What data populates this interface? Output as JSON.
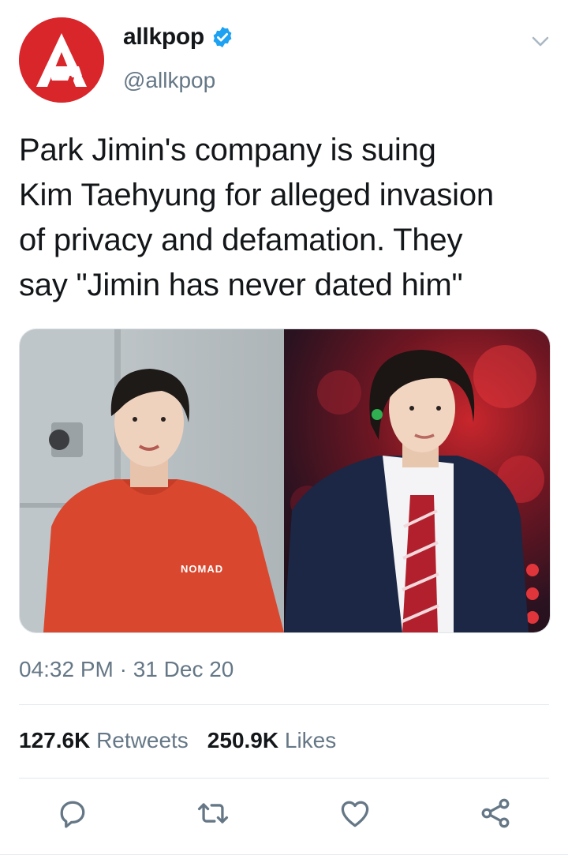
{
  "account": {
    "display_name": "allkpop",
    "handle": "@allkpop",
    "verified": true,
    "avatar_icon": "allkpop-logo-icon",
    "avatar_color": "#d9262b"
  },
  "tweet": {
    "text_lines": [
      "Park Jimin's company is suing",
      "Kim Taehyung for alleged invasion",
      "of privacy and defamation. They",
      "say \"Jimin has never dated him\""
    ],
    "shirt_text": "NOMAD",
    "timestamp": "04:32 PM · 31 Dec 20"
  },
  "stats": {
    "retweets_count": "127.6K",
    "retweets_label": "Retweets",
    "likes_count": "250.9K",
    "likes_label": "Likes"
  },
  "actions": [
    "reply-icon",
    "retweet-icon",
    "like-icon",
    "share-icon"
  ],
  "colors": {
    "text_primary": "#14171a",
    "text_secondary": "#657786",
    "verified_blue": "#1da1f2",
    "divider": "#e1e8ed"
  }
}
